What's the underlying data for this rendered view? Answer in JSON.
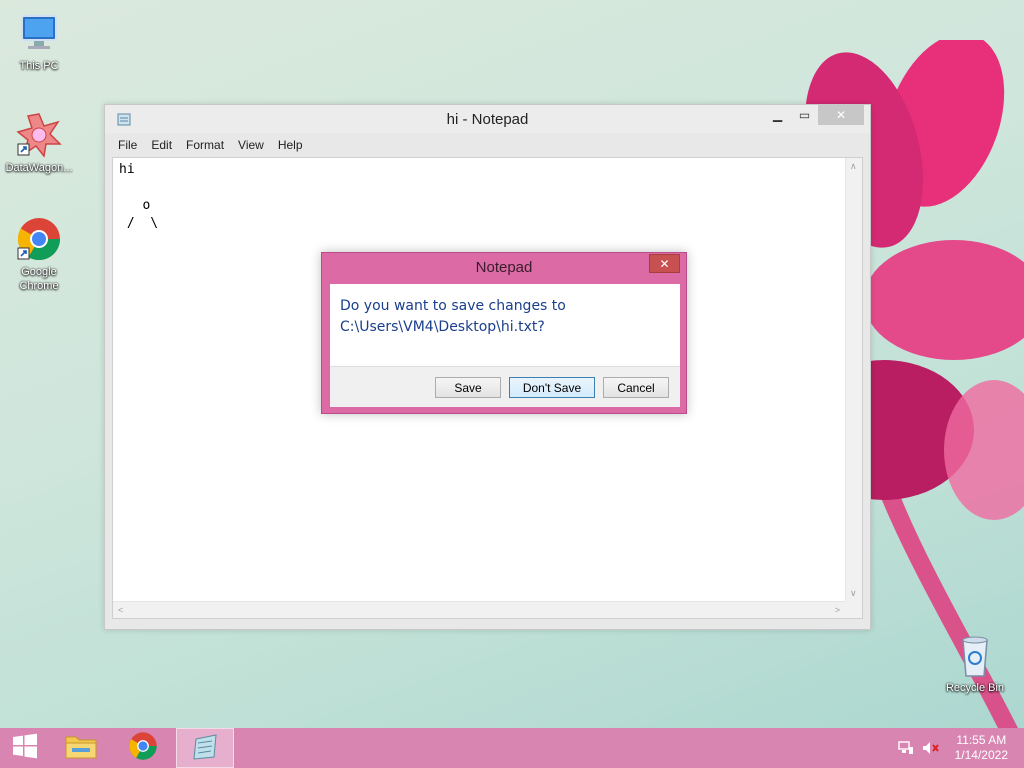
{
  "desktop": {
    "icons": [
      {
        "label": "This PC"
      },
      {
        "label": "DataWagon..."
      },
      {
        "label": "Google Chrome"
      },
      {
        "label": "Recycle Bin"
      }
    ]
  },
  "notepad": {
    "title": "hi - Notepad",
    "menu": [
      "File",
      "Edit",
      "Format",
      "View",
      "Help"
    ],
    "text_lines": [
      "hi",
      "",
      "   o",
      " /  \\"
    ]
  },
  "dialog": {
    "title": "Notepad",
    "message_line1": "Do you want to save changes to",
    "message_line2": "C:\\Users\\VM4\\Desktop\\hi.txt?",
    "buttons": {
      "save": "Save",
      "dont_save": "Don't Save",
      "cancel": "Cancel"
    }
  },
  "taskbar": {
    "clock_time": "11:55 AM",
    "clock_date": "1/14/2022"
  },
  "colors": {
    "taskbar": "#d985b2",
    "dialog_frame": "#db6aa5",
    "dialog_text": "#1a3f8c"
  }
}
